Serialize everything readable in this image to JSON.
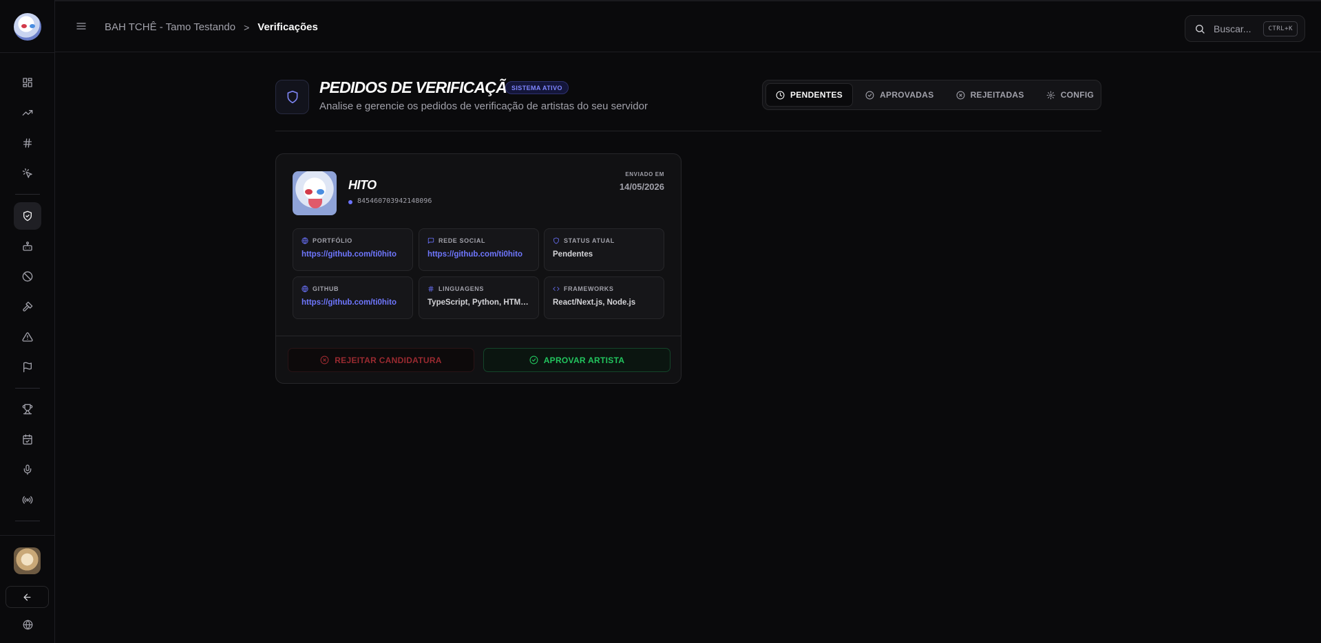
{
  "breadcrumb": {
    "server": "BAH TCHÊ - Tamo Testando",
    "separator": ">",
    "current": "Verificações"
  },
  "search": {
    "placeholder": "Buscar...",
    "shortcut": "CTRL+K"
  },
  "sidebar": {
    "icons": [
      "dashboard-icon",
      "trending-icon",
      "hash-icon",
      "sparkle-cursor-icon",
      "shield-check-icon",
      "bot-icon",
      "ban-icon",
      "hammer-icon",
      "alert-triangle-icon",
      "flag-icon",
      "trophy-icon",
      "calendar-check-icon",
      "mic-icon",
      "broadcast-icon"
    ],
    "active": "shield-check-icon",
    "footer_icons": [
      "arrow-left-icon",
      "globe-icon"
    ]
  },
  "header": {
    "title": "PEDIDOS DE VERIFICAÇÃO",
    "status_badge": "SISTEMA ATIVO",
    "subtitle": "Analise e gerencie os pedidos de verificação de artistas do seu servidor"
  },
  "tabs": [
    {
      "label": "PENDENTES",
      "icon": "clock-icon",
      "active": true
    },
    {
      "label": "APROVADAS",
      "icon": "check-circle-icon",
      "active": false
    },
    {
      "label": "REJEITADAS",
      "icon": "x-circle-icon",
      "active": false
    },
    {
      "label": "CONFIG",
      "icon": "gear-icon",
      "active": false
    }
  ],
  "request": {
    "artist_name": "HITO",
    "artist_id": "845460703942148096",
    "sent_label": "ENVIADO EM",
    "sent_date": "14/05/2026",
    "fields": [
      {
        "label": "PORTFÓLIO",
        "value": "https://github.com/ti0hito",
        "icon": "globe-icon",
        "link": true
      },
      {
        "label": "REDE SOCIAL",
        "value": "https://github.com/ti0hito",
        "icon": "message-icon",
        "link": true
      },
      {
        "label": "STATUS ATUAL",
        "value": "Pendentes",
        "icon": "shield-icon",
        "link": false
      },
      {
        "label": "GITHUB",
        "value": "https://github.com/ti0hito",
        "icon": "globe-icon",
        "link": true
      },
      {
        "label": "LINGUAGENS",
        "value": "TypeScript, Python, HTML...",
        "icon": "hash-icon",
        "link": false
      },
      {
        "label": "FRAMEWORKS",
        "value": "React/Next.js, Node.js",
        "icon": "code-icon",
        "link": false
      }
    ],
    "reject_label": "REJEITAR CANDIDATURA",
    "approve_label": "APROVAR ARTISTA"
  },
  "colors": {
    "accent": "#6f77ff",
    "approve": "#22c55e",
    "reject": "#9a2a30",
    "background": "#0a0a0c"
  }
}
